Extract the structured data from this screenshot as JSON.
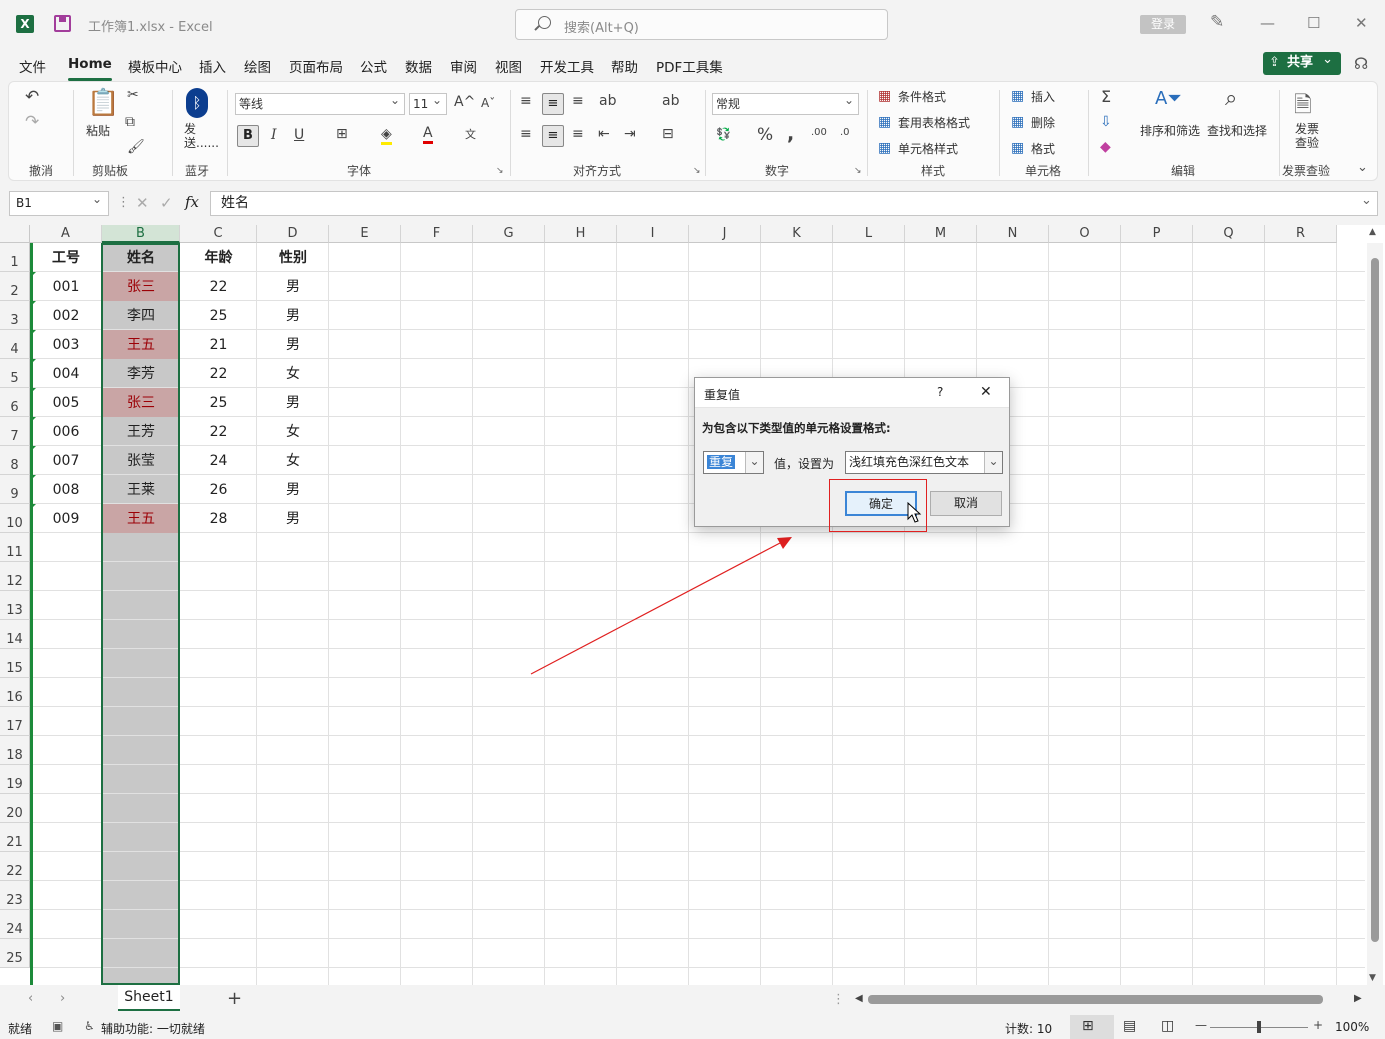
{
  "window": {
    "title": "工作簿1.xlsx  -  Excel",
    "search_placeholder": "搜索(Alt+Q)",
    "login": "登录",
    "app_icon": "X"
  },
  "menu": {
    "items": [
      "文件",
      "Home",
      "模板中心",
      "插入",
      "绘图",
      "页面布局",
      "公式",
      "数据",
      "审阅",
      "视图",
      "开发工具",
      "帮助",
      "PDF工具集"
    ],
    "share": "共享"
  },
  "ribbon": {
    "groups": {
      "undo": "撤消",
      "clipboard": "剪贴板",
      "bluetooth": "蓝牙",
      "font": "字体",
      "align": "对齐方式",
      "number": "数字",
      "styles": "样式",
      "cells": "单元格",
      "edit": "编辑",
      "invoice": "发票查验"
    },
    "paste": "粘贴",
    "send": "发送......",
    "font_name": "等线",
    "font_size": "11",
    "number_format": "常规",
    "cond_format": "条件格式",
    "table_format": "套用表格格式",
    "cell_style": "单元格样式",
    "insert": "插入",
    "delete": "删除",
    "format": "格式",
    "sort_filter": "排序和筛选",
    "find_select": "查找和选择",
    "invoice_check": "发票查验"
  },
  "formula": {
    "name_box": "B1",
    "fx": "fx",
    "content": "姓名"
  },
  "sheet": {
    "columns": [
      "A",
      "B",
      "C",
      "D",
      "E",
      "F",
      "G",
      "H",
      "I",
      "J",
      "K",
      "L",
      "M",
      "N",
      "O",
      "P",
      "Q",
      "R"
    ],
    "rows": [
      "1",
      "2",
      "3",
      "4",
      "5",
      "6",
      "7",
      "8",
      "9",
      "10",
      "11",
      "12",
      "13",
      "14",
      "15",
      "16",
      "17",
      "18",
      "19",
      "20",
      "21",
      "22",
      "23",
      "24",
      "25"
    ],
    "headers": [
      "工号",
      "姓名",
      "年龄",
      "性别"
    ],
    "data": [
      [
        "001",
        "张三",
        "22",
        "男"
      ],
      [
        "002",
        "李四",
        "25",
        "男"
      ],
      [
        "003",
        "王五",
        "21",
        "男"
      ],
      [
        "004",
        "李芳",
        "22",
        "女"
      ],
      [
        "005",
        "张三",
        "25",
        "男"
      ],
      [
        "006",
        "王芳",
        "22",
        "女"
      ],
      [
        "007",
        "张莹",
        "24",
        "女"
      ],
      [
        "008",
        "王莱",
        "26",
        "男"
      ],
      [
        "009",
        "王五",
        "28",
        "男"
      ]
    ],
    "duplicate_rows": [
      0,
      2,
      4,
      8
    ],
    "tab": "Sheet1"
  },
  "dialog": {
    "title": "重复值",
    "help": "?",
    "close": "✕",
    "label": "为包含以下类型值的单元格设置格式:",
    "type": "重复",
    "mid": "值，设置为",
    "style": "浅红填充色深红色文本",
    "ok": "确定",
    "cancel": "取消"
  },
  "status": {
    "ready": "就绪",
    "accessibility": "辅助功能: 一切就绪",
    "count": "计数: 10",
    "zoom": "100%"
  }
}
